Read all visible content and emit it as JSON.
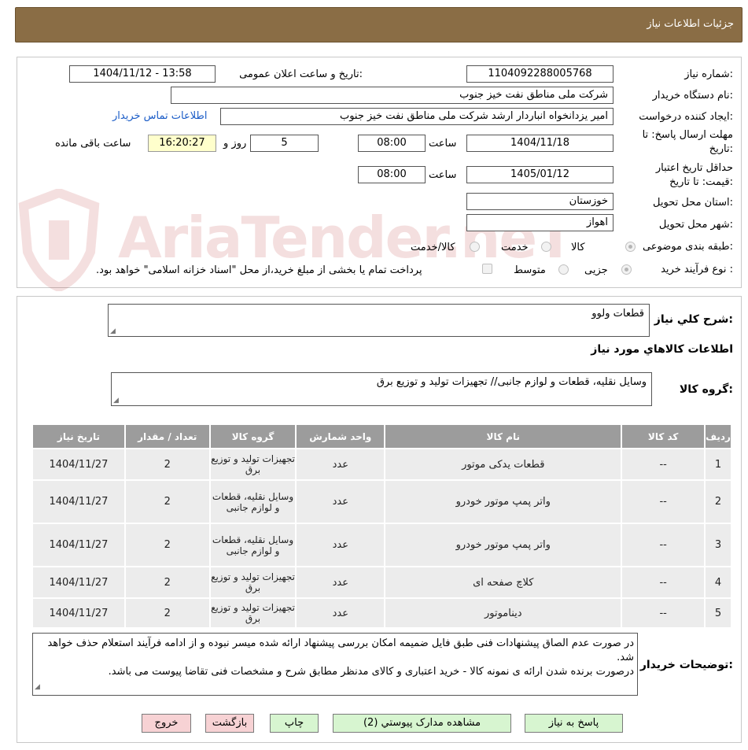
{
  "header": {
    "title": "جزئیات اطلاعات نیاز"
  },
  "info": {
    "need_no_label": "شماره نیاز:",
    "need_no": "1104092288005768",
    "announce_label": "تاریخ و ساعت اعلان عمومی:",
    "announce_value": "1404/11/12 - 13:58",
    "buyer_label": "نام دستگاه خریدار:",
    "buyer_value": "شرکت ملی مناطق نفت خیز جنوب",
    "creator_label": "ایجاد کننده درخواست:",
    "creator_value": "امیر یزدانخواه انباردار ارشد شرکت ملی مناطق نفت خیز جنوب",
    "contact_link": "اطلاعات تماس خریدار",
    "reply_label_1": "مهلت ارسال پاسخ: تا",
    "reply_label_2": "تاریخ:",
    "reply_date": "1404/11/18",
    "time_word": "ساعت",
    "reply_time": "08:00",
    "days_value": "5",
    "days_word": "روز و",
    "remaining_time": "16:20:27",
    "remaining_word": "ساعت باقی مانده",
    "validity_label_1": "حداقل تاریخ اعتبار",
    "validity_label_2": "قیمت: تا تاریخ:",
    "validity_date": "1405/01/12",
    "validity_time": "08:00",
    "province_label": "استان محل تحویل:",
    "province_value": "خوزستان",
    "city_label": "شهر محل تحویل:",
    "city_value": "اهواز",
    "category_label": "طبقه بندی موضوعی:",
    "cat_goods": "کالا",
    "cat_service": "خدمت",
    "cat_both": "کالا/خدمت",
    "process_label": "نوع فرآیند خرید :",
    "proc_partial": "جزیی",
    "proc_medium": "متوسط",
    "payment_note": "پرداخت تمام یا بخشی از مبلغ خرید،از محل \"اسناد خزانه اسلامی\" خواهد بود."
  },
  "watermark": "AriaTender.neT",
  "details": {
    "summary_label": "شرح کلي نياز:",
    "summary_value": "قطعات ولوو",
    "goods_info_title": "اطلاعات کالاهاي مورد نياز",
    "group_label": "گروه کالا:",
    "group_value": "وسایل نقلیه، قطعات و لوازم جانبی// تجهیزات تولید و توزیع برق"
  },
  "table": {
    "headers": [
      "رديف",
      "کد کالا",
      "نام کالا",
      "واحد شمارش",
      "گروه کالا",
      "تعداد / مقدار",
      "تاريخ نياز"
    ],
    "rows": [
      [
        "1",
        "--",
        "قطعات یدکی موتور",
        "عدد",
        "تجهیزات تولید و توزیع برق",
        "2",
        "1404/11/27"
      ],
      [
        "2",
        "--",
        "واتر پمپ موتور خودرو",
        "عدد",
        "وسایل نقلیه، قطعات و لوازم جانبی",
        "2",
        "1404/11/27"
      ],
      [
        "3",
        "--",
        "واتر پمپ موتور خودرو",
        "عدد",
        "وسایل نقلیه، قطعات و لوازم جانبی",
        "2",
        "1404/11/27"
      ],
      [
        "4",
        "--",
        "کلاچ صفحه ای",
        "عدد",
        "تجهیزات تولید و توزیع برق",
        "2",
        "1404/11/27"
      ],
      [
        "5",
        "--",
        "دیناموتور",
        "عدد",
        "تجهیزات تولید و توزیع برق",
        "2",
        "1404/11/27"
      ]
    ]
  },
  "buyer_notes": {
    "label": "توضیحات خریدار:",
    "line1": "در صورت عدم الصاق پیشنهادات فنی طبق فایل ضمیمه امکان بررسی پیشنهاد ارائه شده میسر نبوده و از ادامه فرآیند استعلام حذف خواهد شد.",
    "line2": "درصورت برنده شدن ارائه ی نمونه کالا - خرید اعتباری و کالای مدنظر مطابق شرح و مشخصات فنی تقاضا پیوست می باشد."
  },
  "buttons": {
    "reply": "پاسخ به نیاز",
    "attachments": "مشاهده مدارک پیوستي (2)",
    "print": "چاپ",
    "back": "بازگشت",
    "exit": "خروج"
  },
  "colors": {
    "header_bg": "#8a6d45",
    "table_header": "#9c9c9c",
    "btn_green": "#d7f5d0",
    "btn_pink": "#f7d2d4"
  }
}
